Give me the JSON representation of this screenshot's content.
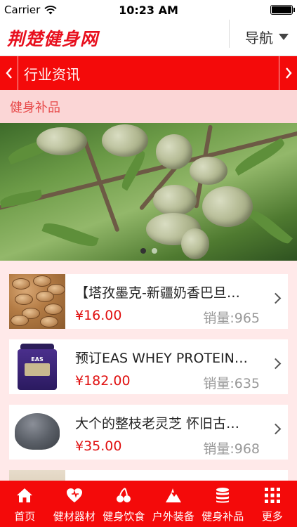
{
  "status_bar": {
    "carrier": "Carrier",
    "time": "10:23 AM",
    "wifi_icon": "wifi-icon",
    "battery_icon": "battery-icon"
  },
  "header": {
    "logo_text": "荆楚健身网",
    "nav_label": "导航",
    "brand_color": "#e8101e"
  },
  "category_bar": {
    "title": "行业资讯",
    "prev_icon": "chevron-left-icon",
    "next_icon": "chevron-right-icon",
    "color": "#f40a0a"
  },
  "subsection": {
    "title": "健身补品"
  },
  "banner": {
    "image": "almonds-on-branch",
    "slides": 2,
    "active_slide": 1
  },
  "products": [
    {
      "name": "【塔孜墨克-新疆奶香巴旦…",
      "price": "¥16.00",
      "sales": "销量:965",
      "thumb": "almonds"
    },
    {
      "name": "预订EAS WHEY PROTEIN…",
      "price": "¥182.00",
      "sales": "销量:635",
      "thumb": "protein-jar"
    },
    {
      "name": "大个的整枝老灵芝 怀旧古…",
      "price": "¥35.00",
      "sales": "销量:968",
      "thumb": "lingzhi"
    },
    {
      "name": "",
      "price": "",
      "sales": "",
      "thumb": "seeds"
    }
  ],
  "tabbar": {
    "items": [
      {
        "label": "首页",
        "icon": "home-icon"
      },
      {
        "label": "健材器材",
        "icon": "heart-icon"
      },
      {
        "label": "健身饮食",
        "icon": "cherry-icon"
      },
      {
        "label": "户外装备",
        "icon": "mountain-icon"
      },
      {
        "label": "健身补品",
        "icon": "database-icon"
      },
      {
        "label": "更多",
        "icon": "grid-icon"
      }
    ]
  }
}
